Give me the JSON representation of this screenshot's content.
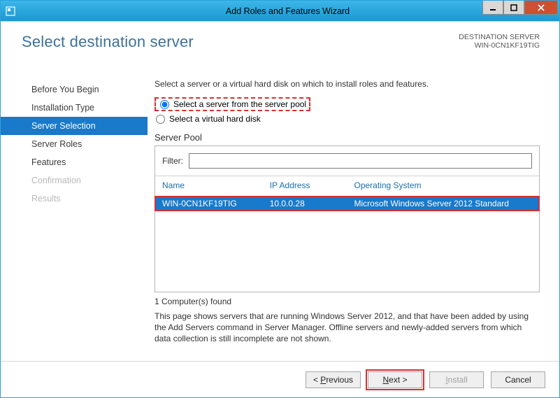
{
  "window": {
    "title": "Add Roles and Features Wizard"
  },
  "header": {
    "page_title": "Select destination server",
    "dest_label": "DESTINATION SERVER",
    "dest_value": "WIN-0CN1KF19TIG"
  },
  "sidebar": {
    "items": [
      {
        "label": "Before You Begin"
      },
      {
        "label": "Installation Type"
      },
      {
        "label": "Server Selection"
      },
      {
        "label": "Server Roles"
      },
      {
        "label": "Features"
      },
      {
        "label": "Confirmation"
      },
      {
        "label": "Results"
      }
    ]
  },
  "main": {
    "instruction": "Select a server or a virtual hard disk on which to install roles and features.",
    "radio1_label": "Select a server from the server pool",
    "radio2_label": "Select a virtual hard disk",
    "pool_label": "Server Pool",
    "filter_label": "Filter:",
    "filter_value": "",
    "columns": {
      "name": "Name",
      "ip": "IP Address",
      "os": "Operating System"
    },
    "rows": [
      {
        "name": "WIN-0CN1KF19TIG",
        "ip": "10.0.0.28",
        "os": "Microsoft Windows Server 2012 Standard"
      }
    ],
    "count_text": "1 Computer(s) found",
    "info_text": "This page shows servers that are running Windows Server 2012, and that have been added by using the Add Servers command in Server Manager. Offline servers and newly-added servers from which data collection is still incomplete are not shown."
  },
  "footer": {
    "previous": "Previous",
    "next": "Next >",
    "install": "Install",
    "cancel": "Cancel"
  }
}
